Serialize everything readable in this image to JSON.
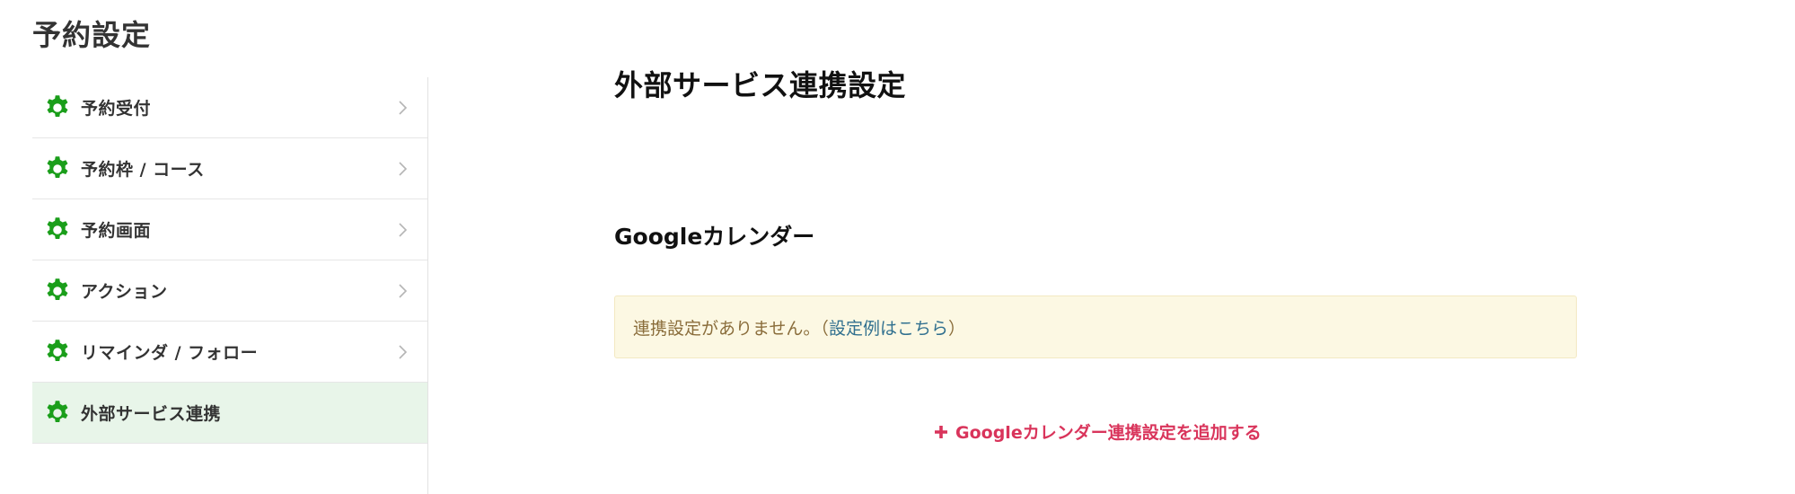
{
  "page": {
    "title": "予約設定"
  },
  "colors": {
    "gear": "#1a9e1a",
    "active_bg": "#e8f5e9",
    "notice_bg": "#fcf8e3",
    "notice_text": "#8a6d3b",
    "link": "#31708f",
    "add_link": "#d9345b"
  },
  "sidebar": {
    "items": [
      {
        "label": "予約受付",
        "icon": "gear-icon",
        "active": false
      },
      {
        "label": "予約枠 / コース",
        "icon": "gear-icon",
        "active": false
      },
      {
        "label": "予約画面",
        "icon": "gear-icon",
        "active": false
      },
      {
        "label": "アクション",
        "icon": "gear-icon",
        "active": false
      },
      {
        "label": "リマインダ / フォロー",
        "icon": "gear-icon",
        "active": false
      },
      {
        "label": "外部サービス連携",
        "icon": "gear-icon",
        "active": true
      }
    ]
  },
  "main": {
    "title": "外部サービス連携設定",
    "section_title": "Googleカレンダー",
    "notice": {
      "text": "連携設定がありません。（",
      "link_label": "設定例はこちら",
      "text_end": "）"
    },
    "add_label": "Googleカレンダー連携設定を追加する"
  }
}
